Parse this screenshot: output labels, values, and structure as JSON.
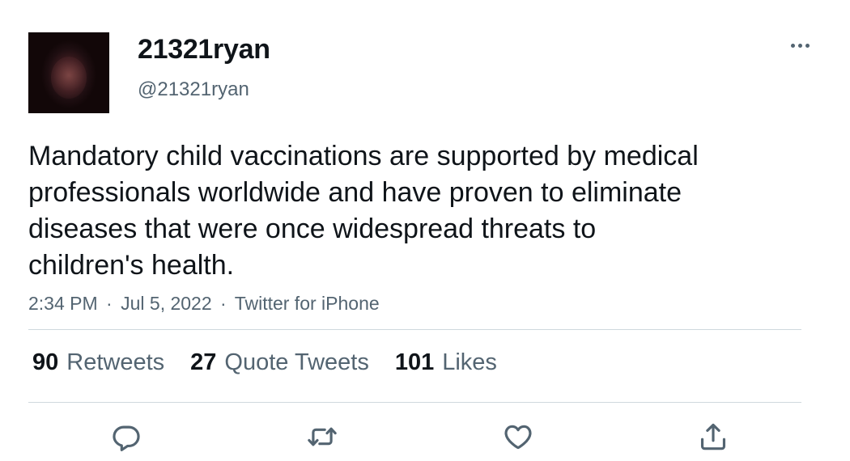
{
  "user": {
    "display_name": "21321ryan",
    "handle": "@21321ryan"
  },
  "tweet": {
    "text_lines": [
      "Mandatory child vaccinations are supported by medical",
      "professionals worldwide and have proven to eliminate",
      "diseases that were once widespread threats to",
      "children's health."
    ],
    "time": "2:34 PM",
    "date": "Jul 5, 2022",
    "source": "Twitter for iPhone",
    "separator": "·"
  },
  "stats": {
    "retweets": {
      "count": "90",
      "label": "Retweets"
    },
    "quotes": {
      "count": "27",
      "label": "Quote Tweets"
    },
    "likes": {
      "count": "101",
      "label": "Likes"
    }
  },
  "icons": {
    "more": "more-horizontal-icon",
    "reply": "reply-icon",
    "retweet": "retweet-icon",
    "like": "heart-icon",
    "share": "share-icon"
  },
  "colors": {
    "text_primary": "#0f1419",
    "text_secondary": "#536471",
    "divider": "#cfd9de"
  }
}
